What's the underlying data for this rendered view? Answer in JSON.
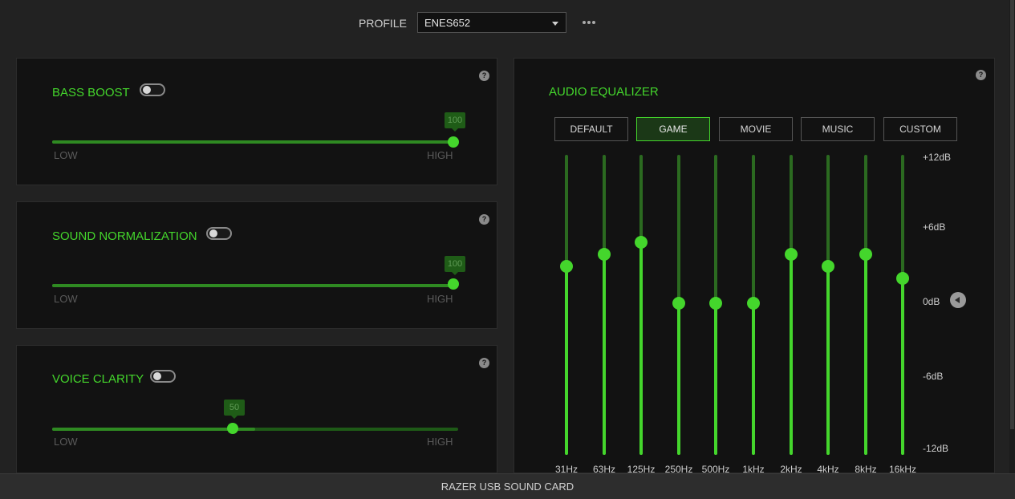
{
  "header": {
    "profile_label": "PROFILE",
    "profile_value": "ENES652",
    "more_icon": "ellipsis-icon"
  },
  "bass_boost": {
    "title": "BASS BOOST",
    "enabled": false,
    "value": "100",
    "low_label": "LOW",
    "high_label": "HIGH",
    "help": "?"
  },
  "sound_normalization": {
    "title": "SOUND NORMALIZATION",
    "enabled": false,
    "value": "100",
    "low_label": "LOW",
    "high_label": "HIGH",
    "help": "?"
  },
  "voice_clarity": {
    "title": "VOICE CLARITY",
    "enabled": false,
    "value": "50",
    "low_label": "LOW",
    "high_label": "HIGH",
    "help": "?"
  },
  "equalizer": {
    "title": "AUDIO EQUALIZER",
    "help": "?",
    "presets": [
      "DEFAULT",
      "GAME",
      "MOVIE",
      "MUSIC",
      "CUSTOM"
    ],
    "active_preset": "GAME",
    "db_labels": [
      "+12dB",
      "+6dB",
      "0dB",
      "-6dB",
      "-12dB"
    ],
    "bands": [
      {
        "freq": "31Hz",
        "db": 3
      },
      {
        "freq": "63Hz",
        "db": 4
      },
      {
        "freq": "125Hz",
        "db": 5
      },
      {
        "freq": "250Hz",
        "db": 0
      },
      {
        "freq": "500Hz",
        "db": 0
      },
      {
        "freq": "1kHz",
        "db": 0
      },
      {
        "freq": "2kHz",
        "db": 4
      },
      {
        "freq": "4kHz",
        "db": 3
      },
      {
        "freq": "8kHz",
        "db": 4
      },
      {
        "freq": "16kHz",
        "db": 2
      }
    ]
  },
  "footer": {
    "device_name": "RAZER USB SOUND CARD"
  },
  "colors": {
    "accent": "#44d62c",
    "background": "#222222",
    "panel": "#121212"
  }
}
